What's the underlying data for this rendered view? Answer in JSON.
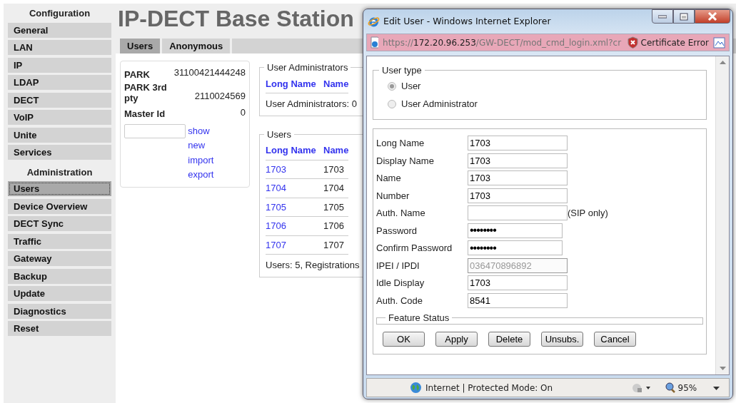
{
  "page": {
    "title": "IP-DECT Base Station"
  },
  "sidebar": {
    "sections": [
      {
        "heading": "Configuration",
        "items": [
          {
            "label": "General",
            "selected": false
          },
          {
            "label": "LAN",
            "selected": false
          },
          {
            "label": "IP",
            "selected": false
          },
          {
            "label": "LDAP",
            "selected": false
          },
          {
            "label": "DECT",
            "selected": false
          },
          {
            "label": "VoIP",
            "selected": false
          },
          {
            "label": "Unite",
            "selected": false
          },
          {
            "label": "Services",
            "selected": false
          }
        ]
      },
      {
        "heading": "Administration",
        "items": [
          {
            "label": "Users",
            "selected": true
          },
          {
            "label": "Device Overview",
            "selected": false
          },
          {
            "label": "DECT Sync",
            "selected": false
          },
          {
            "label": "Traffic",
            "selected": false
          },
          {
            "label": "Gateway",
            "selected": false
          },
          {
            "label": "Backup",
            "selected": false
          },
          {
            "label": "Update",
            "selected": false
          },
          {
            "label": "Diagnostics",
            "selected": false
          },
          {
            "label": "Reset",
            "selected": false
          }
        ]
      }
    ]
  },
  "tabs": [
    {
      "label": "Users",
      "selected": true
    },
    {
      "label": "Anonymous",
      "selected": false
    }
  ],
  "park_info": {
    "rows": [
      {
        "label": "PARK",
        "value": "31100421444248"
      },
      {
        "label": "PARK 3rd pty",
        "value": "2110024569"
      },
      {
        "label": "Master Id",
        "value": "0"
      }
    ],
    "links": [
      "show",
      "new",
      "import",
      "export"
    ]
  },
  "user_administrators": {
    "legend": "User Administrators",
    "columns": [
      "Long Name",
      "Name"
    ],
    "summary": "User Administrators: 0"
  },
  "users": {
    "legend": "Users",
    "columns": [
      "Long Name",
      "Name"
    ],
    "rows": [
      {
        "long_name": "1703",
        "name": "1703"
      },
      {
        "long_name": "1704",
        "name": "1704"
      },
      {
        "long_name": "1705",
        "name": "1705"
      },
      {
        "long_name": "1706",
        "name": "1706"
      },
      {
        "long_name": "1707",
        "name": "1707"
      }
    ],
    "summary": "Users: 5, Registrations"
  },
  "popup": {
    "title": "Edit User - Windows Internet Explorer",
    "address": {
      "scheme": "https://",
      "host": "172.20.96.253",
      "path": "/GW-DECT/mod_cmd_login.xml?cr"
    },
    "certificate": "Certificate Error",
    "user_type": {
      "legend": "User type",
      "disabled": true,
      "options": [
        {
          "label": "User",
          "selected": true
        },
        {
          "label": "User Administrator",
          "selected": false
        }
      ]
    },
    "fields": [
      {
        "label": "Long Name",
        "value": "1703",
        "kind": "text",
        "disabled": false
      },
      {
        "label": "Display Name",
        "value": "1703",
        "kind": "text",
        "disabled": false
      },
      {
        "label": "Name",
        "value": "1703",
        "kind": "text",
        "disabled": false
      },
      {
        "label": "Number",
        "value": "1703",
        "kind": "text",
        "disabled": false
      },
      {
        "label": "Auth. Name",
        "kind": "text",
        "disabled": false,
        "note": "(SIP only)"
      },
      {
        "label": "Password",
        "value": "••••••••",
        "kind": "password",
        "disabled": false
      },
      {
        "label": "Confirm Password",
        "value": "••••••••",
        "kind": "password",
        "disabled": false
      },
      {
        "label": "IPEI / IPDI",
        "value": "036470896892",
        "kind": "text",
        "disabled": true
      },
      {
        "label": "Idle Display",
        "value": "1703",
        "kind": "text",
        "disabled": false
      },
      {
        "label": "Auth. Code",
        "value": "8541",
        "kind": "text",
        "disabled": false
      }
    ],
    "feature_status": {
      "legend": "Feature Status"
    },
    "buttons": [
      "OK",
      "Apply",
      "Delete",
      "Unsubs.",
      "Cancel"
    ],
    "status_bar": {
      "zone": "Internet | Protected Mode: On",
      "zoom": "95%"
    }
  }
}
